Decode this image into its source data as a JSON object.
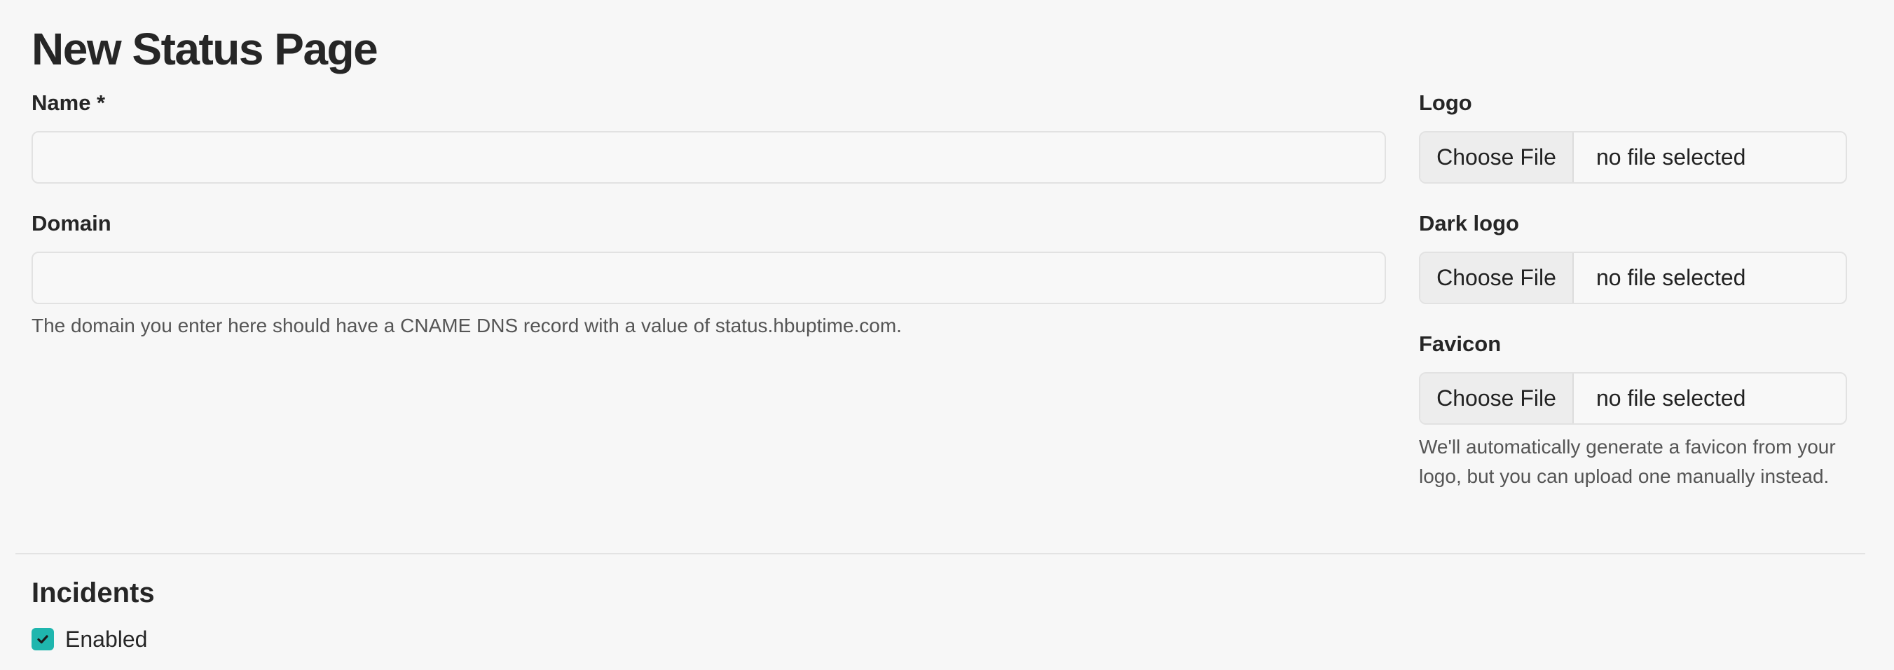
{
  "page": {
    "title": "New Status Page"
  },
  "form": {
    "name": {
      "label": "Name *",
      "value": "",
      "placeholder": ""
    },
    "domain": {
      "label": "Domain",
      "value": "",
      "placeholder": "",
      "help": "The domain you enter here should have a CNAME DNS record with a value of status.hbuptime.com."
    },
    "logo": {
      "label": "Logo",
      "button_label": "Choose File",
      "status": "no file selected"
    },
    "dark_logo": {
      "label": "Dark logo",
      "button_label": "Choose File",
      "status": "no file selected"
    },
    "favicon": {
      "label": "Favicon",
      "button_label": "Choose File",
      "status": "no file selected",
      "help": "We'll automatically generate a favicon from your logo, but you can upload one manually instead."
    }
  },
  "incidents": {
    "title": "Incidents",
    "enabled_label": "Enabled",
    "enabled": true
  },
  "colors": {
    "background": "#f7f7f7",
    "checkbox_accent": "#1fb6ae",
    "border": "#e2e2e2"
  },
  "icons": {
    "checkbox": "checkmark-icon"
  }
}
